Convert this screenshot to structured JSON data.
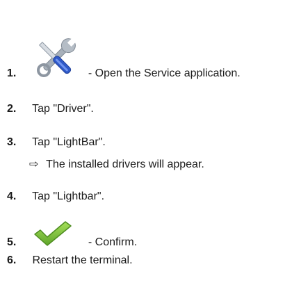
{
  "steps": [
    {
      "number": "1.",
      "icon": "service-tools-icon",
      "text": "- Open the Service application."
    },
    {
      "number": "2.",
      "text": "Tap \"Driver\"."
    },
    {
      "number": "3.",
      "text": "Tap \"LightBar\"."
    },
    {
      "number": "4.",
      "text": "Tap \"Lightbar\"."
    },
    {
      "number": "5.",
      "icon": "confirm-checkmark-icon",
      "text": "- Confirm."
    },
    {
      "number": "6.",
      "text": "Restart the terminal."
    }
  ],
  "step3_result": {
    "arrow": "⇨",
    "text": "The installed drivers will appear."
  },
  "colors": {
    "text": "#1a1a1a",
    "wrench": "#9aa3ad",
    "screwdriver_shaft": "#2f59c8",
    "checkmark": "#7cc23a"
  }
}
